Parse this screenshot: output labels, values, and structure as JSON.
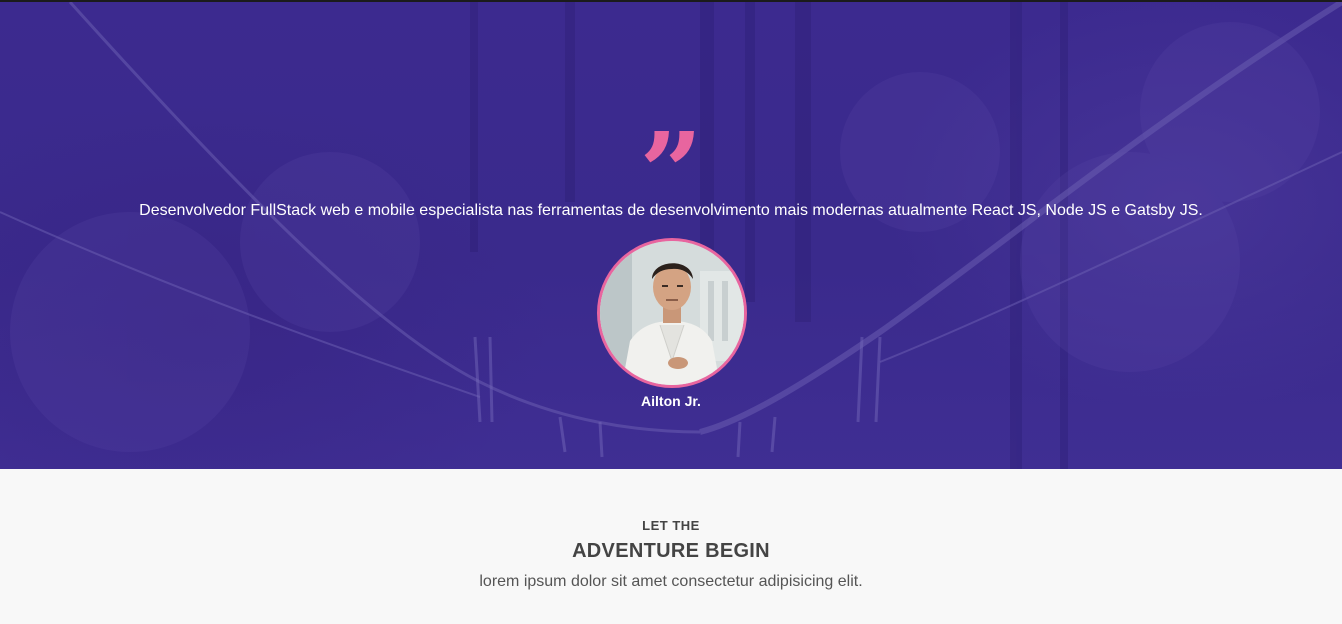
{
  "theme": {
    "hero_overlay": "#3a2a8c",
    "accent": "#e8659f",
    "hero_text": "#ffffff",
    "section_background": "#f8f8f8",
    "section_text": "#444444"
  },
  "testimonial": {
    "quote_icon": "quote-icon",
    "quote_mark": "”",
    "text": "Desenvolvedor FullStack web e mobile especialista nas ferramentas de desenvolvimento mais modernas atualmente React JS, Node JS e Gatsby JS.",
    "author_name": "Ailton Jr."
  },
  "adventure": {
    "eyebrow": "LET THE",
    "title": "ADVENTURE BEGIN",
    "subtitle": "lorem ipsum dolor sit amet consectetur adipisicing elit."
  }
}
